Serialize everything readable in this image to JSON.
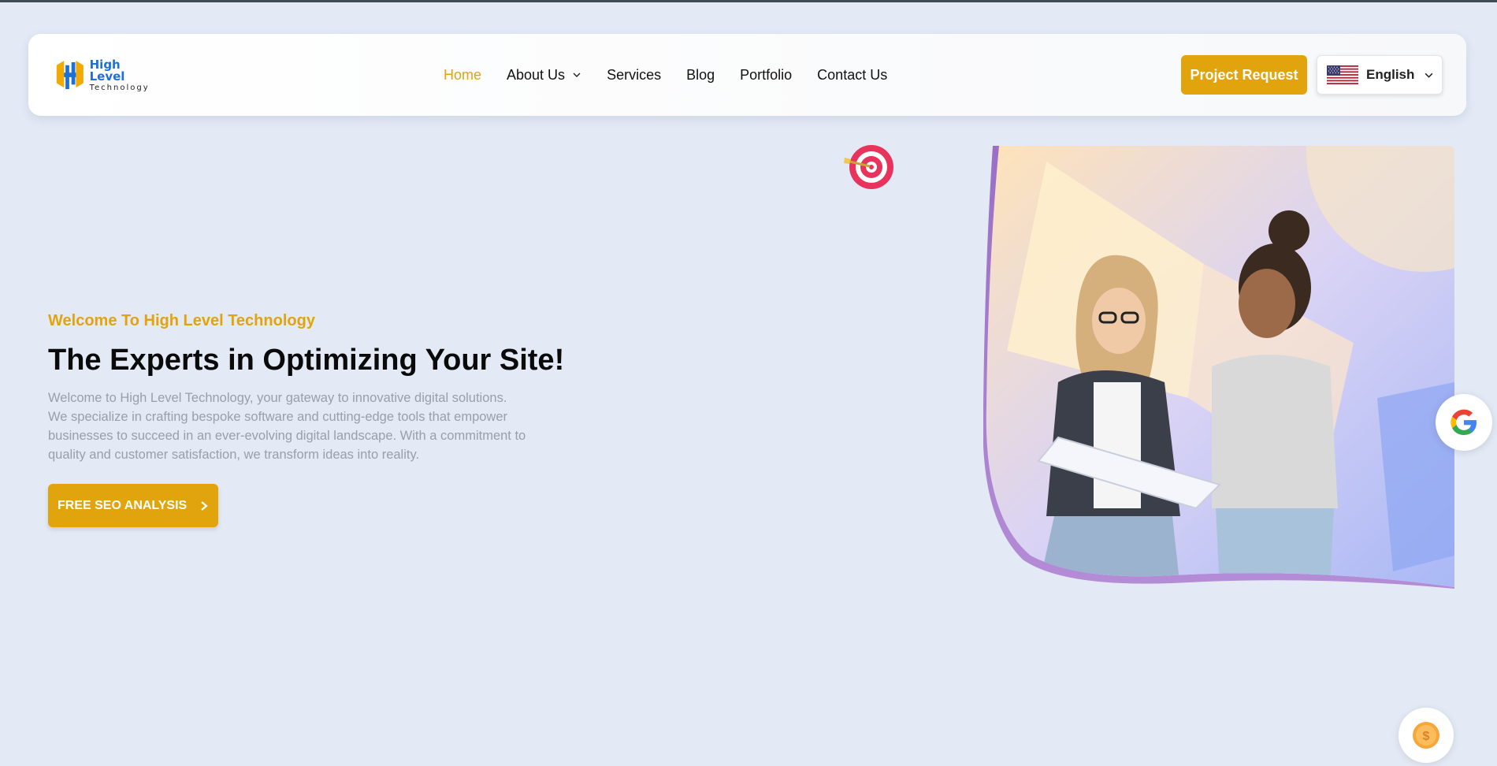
{
  "brand": {
    "name_line1": "High Level",
    "name_line2": "Technology",
    "colors": {
      "accent": "#e2a40c",
      "logo_blue": "#1e6fd8",
      "background": "#e3e9f5"
    }
  },
  "nav": {
    "items": [
      {
        "label": "Home",
        "active": true,
        "has_dropdown": false
      },
      {
        "label": "About Us",
        "active": false,
        "has_dropdown": true
      },
      {
        "label": "Services",
        "active": false,
        "has_dropdown": false
      },
      {
        "label": "Blog",
        "active": false,
        "has_dropdown": false
      },
      {
        "label": "Portfolio",
        "active": false,
        "has_dropdown": false
      },
      {
        "label": "Contact Us",
        "active": false,
        "has_dropdown": false
      }
    ]
  },
  "header": {
    "cta_label": "Project Request",
    "language": {
      "selected": "English",
      "flag_icon": "us-flag-icon"
    }
  },
  "hero": {
    "eyebrow": "Welcome To High Level Technology",
    "title": "The Experts in Optimizing Your Site!",
    "description": "Welcome to High Level Technology, your gateway to innovative digital solutions. We specialize in crafting bespoke software and cutting-edge tools that empower businesses to succeed in an ever-evolving digital landscape. With a commitment to quality and customer satisfaction, we transform ideas into reality.",
    "cta_label": "FREE SEO ANALYSIS"
  },
  "icons": {
    "target": "target-icon",
    "google": "google-icon",
    "coin": "coin-icon",
    "hero_image": "two-women-reviewing-document-illustration"
  }
}
